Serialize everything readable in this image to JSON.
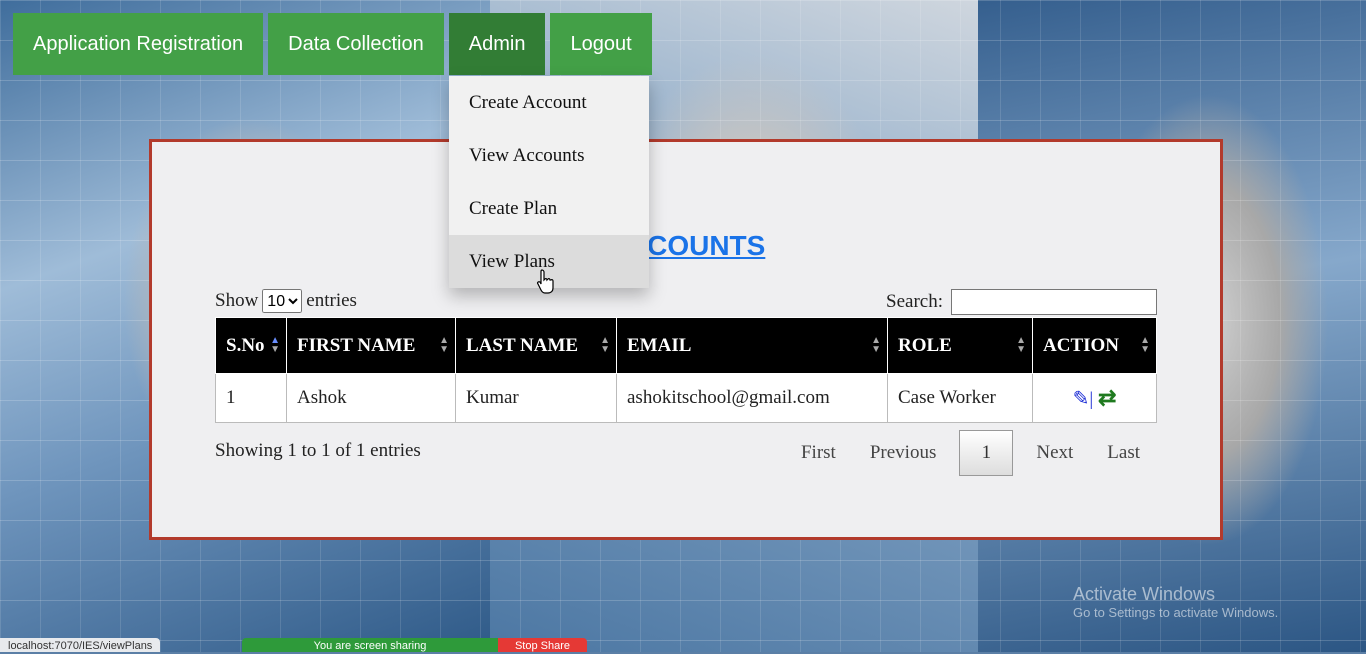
{
  "nav": {
    "items": [
      "Application Registration",
      "Data Collection",
      "Admin",
      "Logout"
    ],
    "active": "Admin"
  },
  "dropdown": {
    "items": [
      "Create Account",
      "View Accounts",
      "Create Plan",
      "View Plans"
    ],
    "hovered": "View Plans"
  },
  "panel": {
    "heading": "ACCOUNTS",
    "show_label": "Show",
    "entries_label": "entries",
    "page_size": "10",
    "page_size_options": [
      "10"
    ],
    "search_label": "Search:",
    "search_value": ""
  },
  "table": {
    "columns": [
      "S.No",
      "FIRST NAME",
      "LAST NAME",
      "EMAIL",
      "ROLE",
      "ACTION"
    ],
    "rows": [
      {
        "sno": "1",
        "first": "Ashok",
        "last": "Kumar",
        "email": "ashokitschool@gmail.com",
        "role": "Case Worker"
      }
    ]
  },
  "footer": {
    "info": "Showing 1 to 1 of 1 entries",
    "first": "First",
    "previous": "Previous",
    "current_page": "1",
    "next": "Next",
    "last": "Last"
  },
  "browser": {
    "status_url": "localhost:7070/IES/viewPlans",
    "share_text": "You are screen sharing",
    "stop_share": "Stop Share"
  },
  "watermark": {
    "line1": "Activate Windows",
    "line2": "Go to Settings to activate Windows."
  },
  "colors": {
    "nav_green": "#43a047",
    "nav_active": "#327d35",
    "heading_blue": "#1a73e8",
    "panel_border": "#b23a2c"
  },
  "icons": [
    "edit-pencil-icon",
    "swap-arrows-icon"
  ]
}
